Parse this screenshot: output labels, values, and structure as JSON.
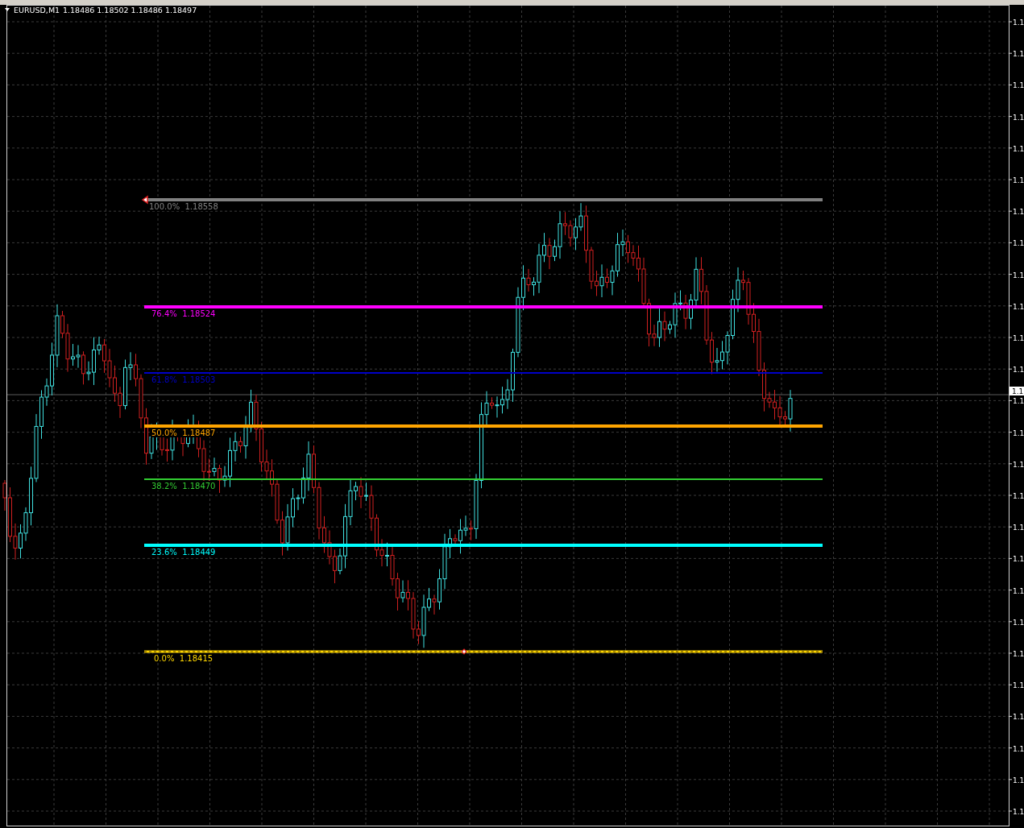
{
  "chart": {
    "symbol": "EURUSD,M1",
    "ohlc": "1.18486 1.18502 1.18486 1.18497",
    "fibonacci_levels": [
      {
        "label": "100.0%  1.18558",
        "color": "#808080"
      },
      {
        "label": "76.4%  1.18524",
        "color": "#ff00ff"
      },
      {
        "label": "61.8%  1.18503",
        "color": "#0000c8"
      },
      {
        "label": "50.0%  1.18487",
        "color": "#ffa500"
      },
      {
        "label": "38.2%  1.18470",
        "color": "#32cd32"
      },
      {
        "label": "23.6%  1.18449",
        "color": "#00ffff"
      },
      {
        "label": "0.0%  1.18415",
        "color": "#ffd700"
      }
    ],
    "price_axis": {
      "labels": [
        "1.1",
        "1.1",
        "1.1",
        "1.1",
        "1.1",
        "1.1",
        "1.1",
        "1.1",
        "1.1",
        "1.1",
        "1.1",
        "1.1",
        "1.1",
        "1.1",
        "1.1",
        "1.1",
        "1.1",
        "1.1",
        "1.1",
        "1.1",
        "1.1",
        "1.1",
        "1.1",
        "1.1",
        "1.1",
        "1.1"
      ],
      "current_price": "1.1"
    }
  }
}
